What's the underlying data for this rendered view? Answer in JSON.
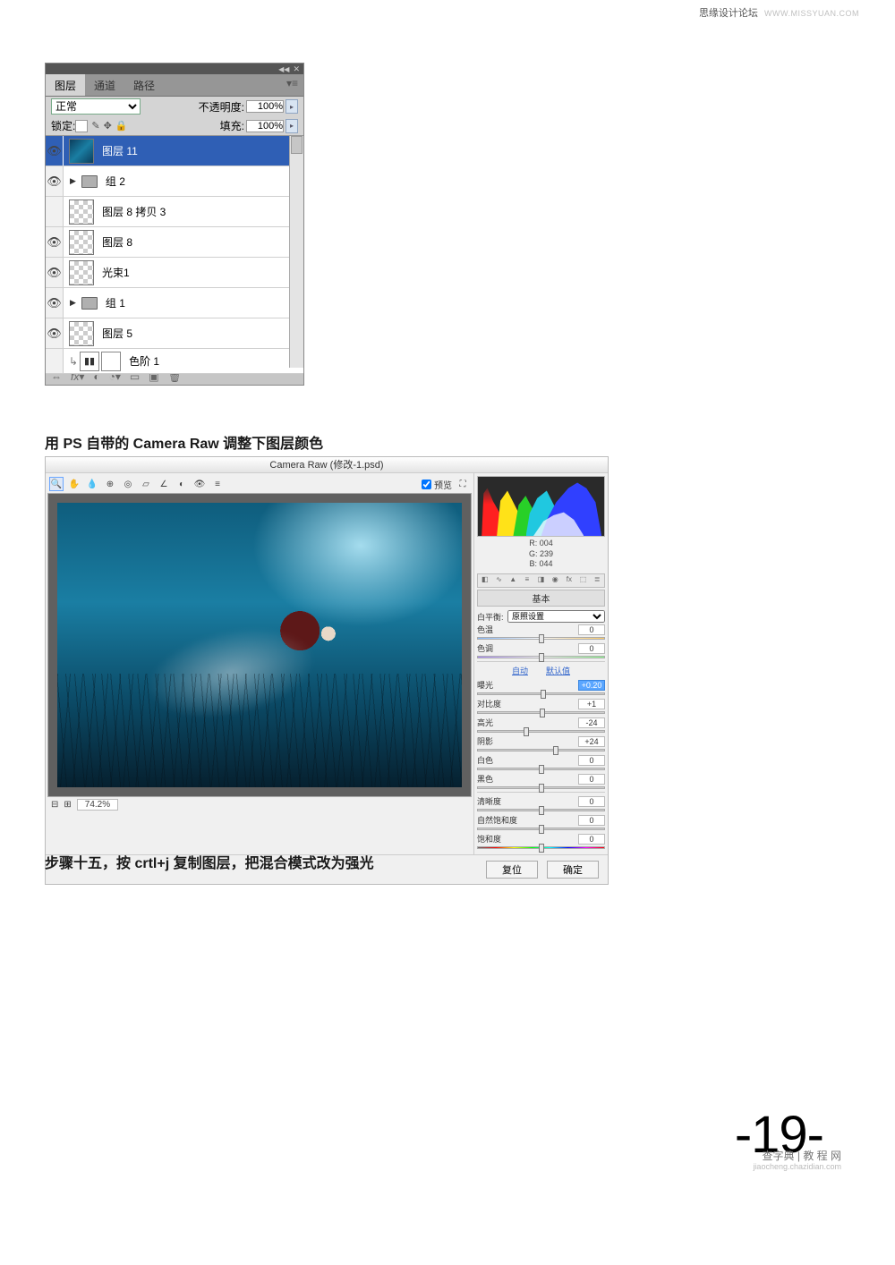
{
  "header": {
    "site": "思缘设计论坛",
    "url": "WWW.MISSYUAN.COM"
  },
  "layers_panel": {
    "tabs": {
      "layers": "图层",
      "channels": "通道",
      "paths": "路径"
    },
    "blend_mode": "正常",
    "opacity_label": "不透明度:",
    "opacity_value": "100%",
    "lock_label": "锁定:",
    "fill_label": "填充:",
    "fill_value": "100%",
    "layers": [
      {
        "name": "图层 11"
      },
      {
        "name": "组 2"
      },
      {
        "name": "图层 8 拷贝 3"
      },
      {
        "name": "图层 8"
      },
      {
        "name": "光束1"
      },
      {
        "name": "组 1"
      },
      {
        "name": "图层 5"
      }
    ],
    "adjustment": "色阶 1"
  },
  "para1": "用 PS 自带的 Camera Raw 调整下图层颜色",
  "para2": "步骤十五，按 crtl+j 复制图层，把混合模式改为强光",
  "camera_raw": {
    "title": "Camera Raw (修改-1.psd)",
    "preview_label": "预览",
    "zoom_value": "74.2%",
    "rgb": {
      "r": "R: 004",
      "g": "G: 239",
      "b": "B: 044"
    },
    "section_title": "基本",
    "wb_label": "白平衡:",
    "wb_value": "原照设置",
    "temp_label": "色温",
    "temp_value": "0",
    "tint_label": "色调",
    "tint_value": "0",
    "auto": "自动",
    "default": "默认值",
    "exposure_label": "曝光",
    "exposure_value": "+0.20",
    "contrast_label": "对比度",
    "contrast_value": "+1",
    "highlight_label": "高光",
    "highlight_value": "-24",
    "shadow_label": "阴影",
    "shadow_value": "+24",
    "white_label": "白色",
    "white_value": "0",
    "black_label": "黑色",
    "black_value": "0",
    "clarity_label": "清晰度",
    "clarity_value": "0",
    "vibrance_label": "自然饱和度",
    "vibrance_value": "0",
    "saturation_label": "饱和度",
    "saturation_value": "0",
    "reset_btn": "复位",
    "ok_btn": "确定"
  },
  "page_number": "19",
  "footer": {
    "main": "查字典 | 教 程 网",
    "sub": "jiaocheng.chazidian.com"
  }
}
